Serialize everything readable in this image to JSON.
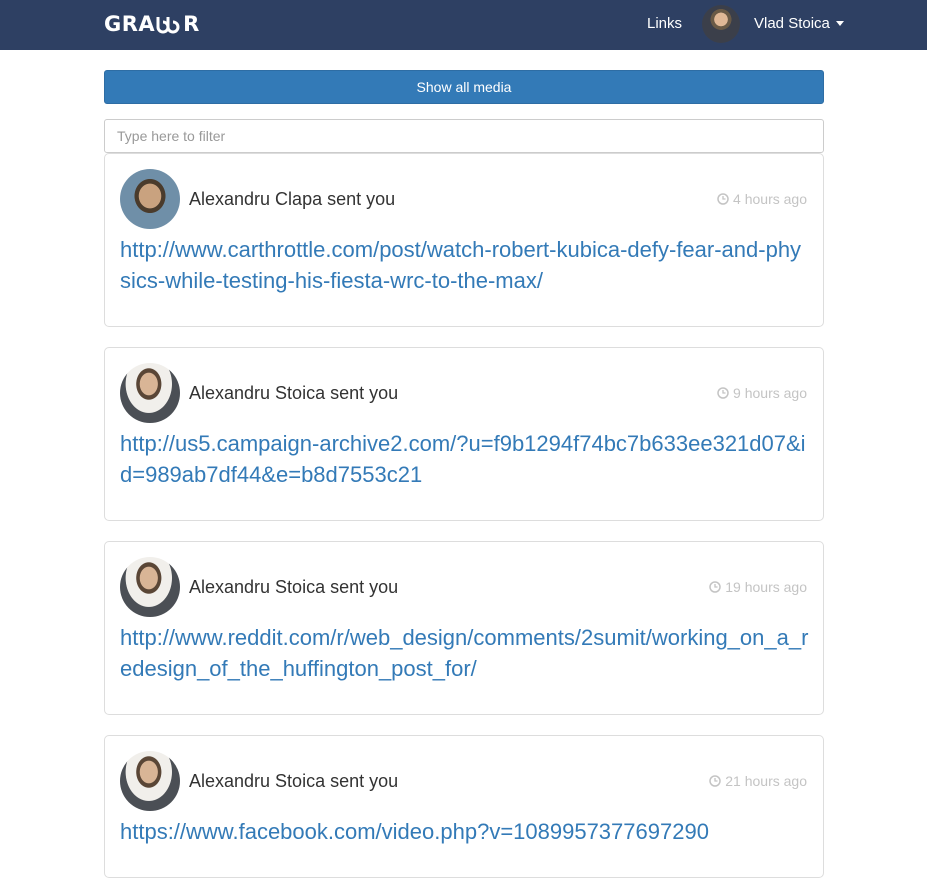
{
  "header": {
    "logo_text": "GRABBR",
    "nav_link": "Links",
    "user_name": "Vlad Stoica"
  },
  "actions": {
    "show_all_label": "Show all media",
    "filter_placeholder": "Type here to filter"
  },
  "items": [
    {
      "sender": "Alexandru Clapa sent you",
      "time": "4 hours ago",
      "url": "http://www.carthrottle.com/post/watch-robert-kubica-defy-fear-and-physics-while-testing-his-fiesta-wrc-to-the-max/"
    },
    {
      "sender": "Alexandru Stoica sent you",
      "time": "9 hours ago",
      "url": "http://us5.campaign-archive2.com/?u=f9b1294f74bc7b633ee321d07&id=989ab7df44&e=b8d7553c21"
    },
    {
      "sender": "Alexandru Stoica sent you",
      "time": "19 hours ago",
      "url": "http://www.reddit.com/r/web_design/comments/2sumit/working_on_a_redesign_of_the_huffington_post_for/"
    },
    {
      "sender": "Alexandru Stoica sent you",
      "time": "21 hours ago",
      "url": "https://www.facebook.com/video.php?v=1089957377697290"
    }
  ],
  "colors": {
    "navbar": "#2e4063",
    "primary": "#337ab7",
    "muted": "#c4c4c4"
  },
  "icons": {
    "time": "clock-icon",
    "dropdown": "caret-down-icon"
  }
}
